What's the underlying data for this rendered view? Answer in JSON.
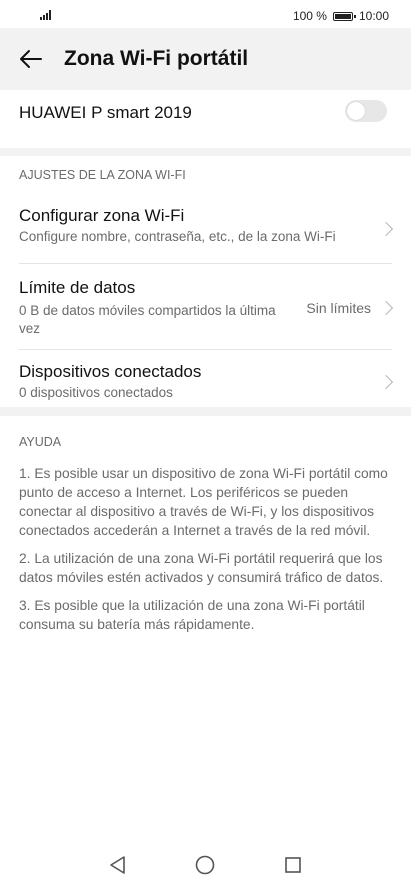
{
  "status": {
    "battery_text": "100 %",
    "time": "10:00"
  },
  "appbar": {
    "title": "Zona Wi-Fi portátil"
  },
  "hotspot_toggle": {
    "label": "HUAWEI P smart 2019",
    "state": "off"
  },
  "settings_section": {
    "header": "AJUSTES DE LA ZONA WI-FI",
    "items": [
      {
        "title": "Configurar zona Wi-Fi",
        "subtitle": "Configure nombre, contraseña, etc., de la zona Wi-Fi"
      },
      {
        "title": "Límite de datos",
        "subtitle": "0 B de datos móviles compartidos la última vez",
        "value": "Sin límites"
      },
      {
        "title": "Dispositivos conectados",
        "subtitle": "0 dispositivos conectados"
      }
    ]
  },
  "help": {
    "header": "AYUDA",
    "paragraphs": [
      "1. Es posible usar un dispositivo de zona Wi-Fi portátil como punto de acceso a Internet. Los periféricos se pueden conectar al dispositivo a través de Wi-Fi, y los dispositivos conectados accederán a Internet a través de la red móvil.",
      "2. La utilización de una zona Wi-Fi portátil requerirá que los datos móviles estén activados y consumirá tráfico de datos.",
      "3. Es posible que la utilización de una zona Wi-Fi portátil consuma su batería más rápidamente."
    ]
  },
  "navbar": {
    "back_icon": "triangle-back-icon",
    "home_icon": "circle-home-icon",
    "recents_icon": "square-recents-icon"
  }
}
